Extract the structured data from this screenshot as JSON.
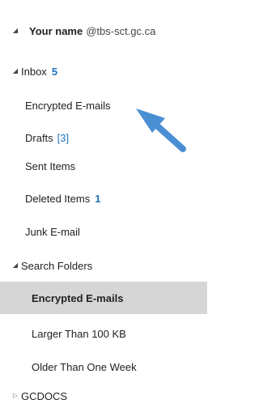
{
  "account": {
    "name": "Your name",
    "domain": "@tbs-sct.gc.ca"
  },
  "folders": {
    "inbox": {
      "label": "Inbox",
      "count": "5"
    },
    "encrypted_emails": {
      "label": "Encrypted E-mails"
    },
    "drafts": {
      "label": "Drafts",
      "count": "[3]"
    },
    "sent_items": {
      "label": "Sent Items"
    },
    "deleted_items": {
      "label": "Deleted Items",
      "count": "1"
    },
    "junk_email": {
      "label": "Junk E-mail"
    }
  },
  "search_folders": {
    "label": "Search Folders",
    "items": [
      {
        "label": "Encrypted E-mails",
        "selected": true
      },
      {
        "label": "Larger Than 100 KB"
      },
      {
        "label": "Older Than One Week"
      }
    ]
  },
  "gcdocs": {
    "label": "GCDOCS"
  },
  "colors": {
    "accent": "#1e73be",
    "selected_bg": "#d6d6d6",
    "arrow": "#4a8fd4"
  },
  "icons": {
    "expanded": "expanded-caret-icon",
    "collapsed": "collapsed-caret-icon",
    "pointer": "pointer-arrow-icon"
  }
}
